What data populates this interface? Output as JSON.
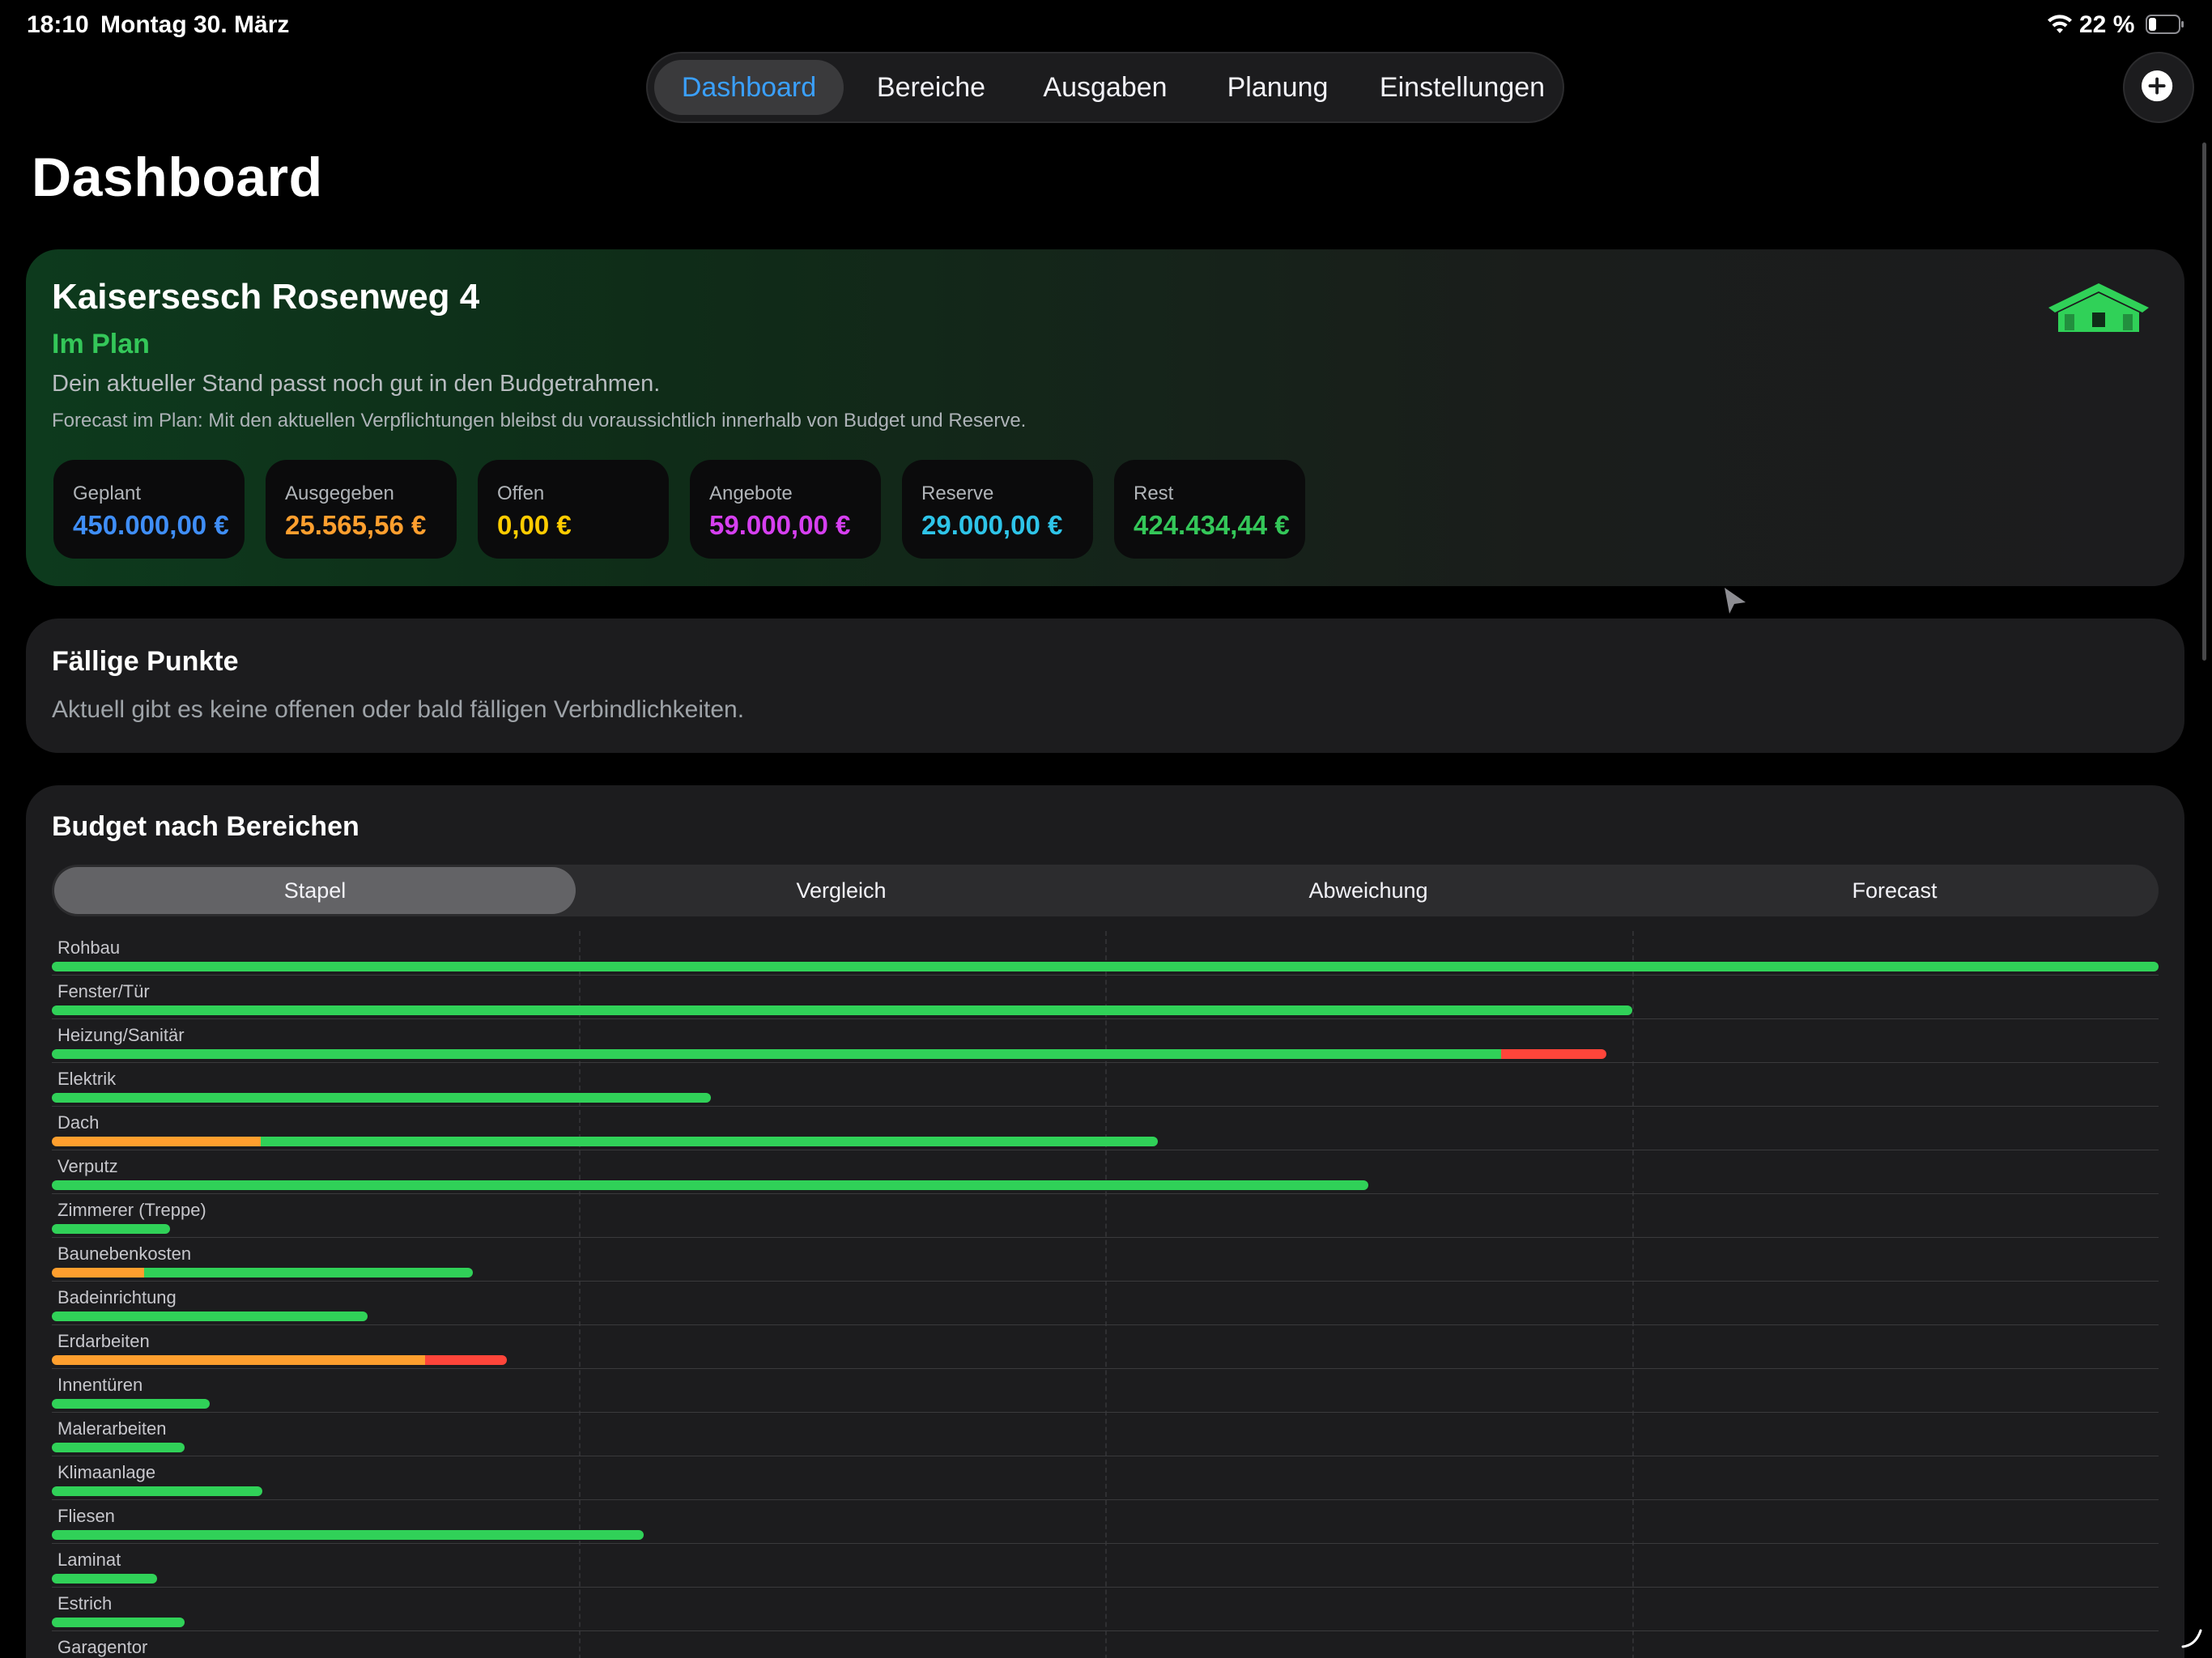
{
  "status_bar": {
    "time": "18:10",
    "date": "Montag 30. März",
    "battery": "22 %"
  },
  "tabs": [
    {
      "label": "Dashboard",
      "active": true
    },
    {
      "label": "Bereiche",
      "active": false
    },
    {
      "label": "Ausgaben",
      "active": false
    },
    {
      "label": "Planung",
      "active": false
    },
    {
      "label": "Einstellungen",
      "active": false
    }
  ],
  "page_title": "Dashboard",
  "project": {
    "name": "Kaisersesch Rosenweg 4",
    "status": "Im Plan",
    "status_color": "#34c759",
    "subtitle": "Dein aktueller Stand passt noch gut in den Budgetrahmen.",
    "forecast": "Forecast im Plan: Mit den aktuellen Verpflichtungen bleibst du voraussichtlich innerhalb von Budget und Reserve.",
    "icon": "house-icon",
    "kpis": [
      {
        "label": "Geplant",
        "value": "450.000,00 €",
        "color": "#3f8ef7"
      },
      {
        "label": "Ausgegeben",
        "value": "25.565,56 €",
        "color": "#ff9f2e"
      },
      {
        "label": "Offen",
        "value": "0,00 €",
        "color": "#ffcc00"
      },
      {
        "label": "Angebote",
        "value": "59.000,00 €",
        "color": "#d63ff0"
      },
      {
        "label": "Reserve",
        "value": "29.000,00 €",
        "color": "#2ec4e8"
      },
      {
        "label": "Rest",
        "value": "424.434,44 €",
        "color": "#34c759"
      }
    ]
  },
  "due": {
    "title": "Fällige Punkte",
    "text": "Aktuell gibt es keine offenen oder bald fälligen Verbindlichkeiten."
  },
  "budget": {
    "title": "Budget nach Bereichen",
    "segments": [
      {
        "label": "Stapel",
        "active": true
      },
      {
        "label": "Vergleich",
        "active": false
      },
      {
        "label": "Abweichung",
        "active": false
      },
      {
        "label": "Forecast",
        "active": false
      }
    ]
  },
  "colors": {
    "green": "#30d158",
    "orange": "#ff9f2e",
    "red": "#ff453a"
  },
  "chart_data": {
    "type": "bar",
    "orientation": "horizontal",
    "stacked": true,
    "xlim": [
      0,
      1
    ],
    "grid": true,
    "categories": [
      "Rohbau",
      "Fenster/Tür",
      "Heizung/Sanitär",
      "Elektrik",
      "Dach",
      "Verputz",
      "Zimmerer (Treppe)",
      "Baunebenkosten",
      "Badeinrichtung",
      "Erdarbeiten",
      "Innentüren",
      "Malerarbeiten",
      "Klimaanlage",
      "Fliesen",
      "Laminat",
      "Estrich",
      "Garagentor"
    ],
    "series": [
      {
        "color": "#ff9f2e",
        "values": [
          0,
          0,
          0,
          0,
          0.099,
          0,
          0,
          0.044,
          0,
          0.177,
          0,
          0,
          0,
          0,
          0,
          0,
          0
        ]
      },
      {
        "color": "#30d158",
        "values": [
          1.0,
          0.75,
          0.688,
          0.313,
          0.426,
          0.625,
          0.056,
          0.156,
          0.15,
          0,
          0.075,
          0.063,
          0.1,
          0.281,
          0.05,
          0.063,
          0.05
        ]
      },
      {
        "color": "#ff453a",
        "values": [
          0,
          0,
          0.05,
          0,
          0,
          0,
          0,
          0,
          0,
          0.039,
          0,
          0,
          0,
          0,
          0,
          0,
          0
        ]
      }
    ]
  }
}
